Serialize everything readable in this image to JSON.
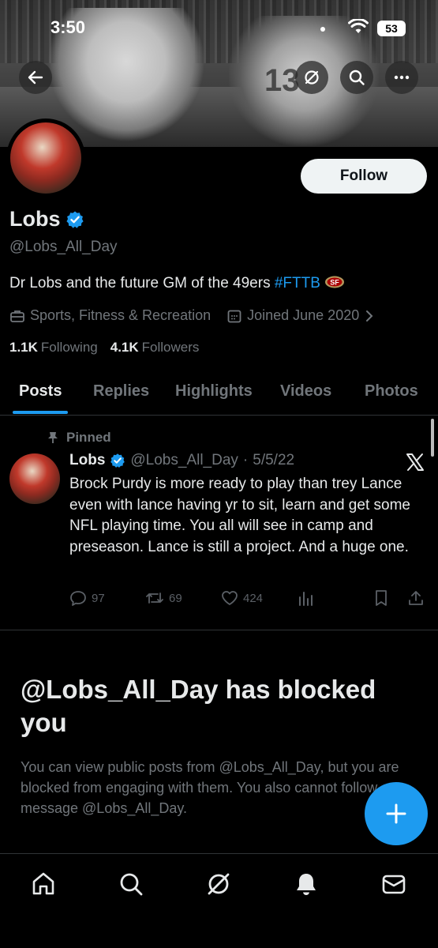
{
  "status_bar": {
    "time": "3:50",
    "battery": "53"
  },
  "banner": {
    "jersey_number": "13"
  },
  "profile": {
    "follow_label": "Follow",
    "name": "Lobs",
    "handle": "@Lobs_All_Day",
    "bio_text": "Dr Lobs and the future GM of the 49ers ",
    "bio_hashtag": "#FTTB",
    "category": "Sports, Fitness & Recreation",
    "joined": "Joined June 2020",
    "following_count": "1.1K",
    "following_label": "Following",
    "followers_count": "4.1K",
    "followers_label": "Followers"
  },
  "tabs": [
    {
      "label": "Posts",
      "active": true
    },
    {
      "label": "Replies"
    },
    {
      "label": "Highlights"
    },
    {
      "label": "Videos"
    },
    {
      "label": "Photos"
    }
  ],
  "pinned_post": {
    "pinned_label": "Pinned",
    "author": "Lobs",
    "handle": "@Lobs_All_Day",
    "separator": "·",
    "date": "5/5/22",
    "text": "Brock Purdy is more ready to play than trey Lance even with lance having yr to sit, learn and get some NFL playing time. You all will see in camp and preseason. Lance is still a project. And a huge one.",
    "replies": "97",
    "reposts": "69",
    "likes": "424"
  },
  "blocked": {
    "title": "@Lobs_All_Day has blocked you",
    "text": "You can view public posts from @Lobs_All_Day, but you are blocked from engaging with them. You also cannot follow or message @Lobs_All_Day."
  },
  "bottom_nav": {
    "items": [
      "home-icon",
      "search-icon",
      "grok-icon",
      "notifications-icon",
      "messages-icon"
    ]
  },
  "colors": {
    "accent": "#1d9bf0",
    "background": "#000000",
    "text_primary": "#e7e9ea",
    "text_secondary": "#71767b"
  }
}
